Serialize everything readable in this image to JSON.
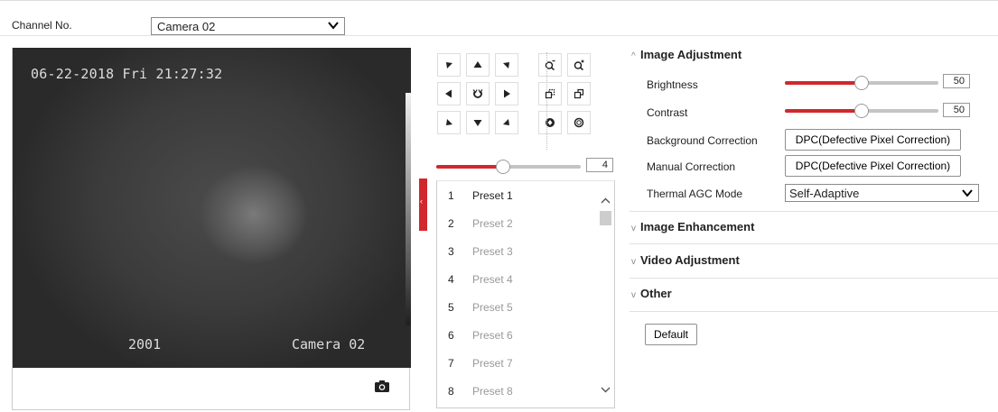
{
  "channel": {
    "label": "Channel No.",
    "selected": "Camera 02"
  },
  "video": {
    "osd_datetime": "06-22-2018 Fri 21:27:32",
    "osd_number": "2001",
    "osd_camera": "Camera 02"
  },
  "ptz": {
    "speed_value": "4",
    "speed_fraction": 0.46,
    "icons": [
      "arrow-up-left-icon",
      "arrow-up-icon",
      "arrow-up-right-icon",
      "zoom-out-icon",
      "zoom-in-icon",
      "arrow-left-icon",
      "auto-rotate-icon",
      "arrow-right-icon",
      "focus-near-icon",
      "focus-far-icon",
      "arrow-down-left-icon",
      "arrow-down-icon",
      "arrow-down-right-icon",
      "iris-close-icon",
      "iris-open-icon"
    ]
  },
  "presets": [
    {
      "num": "1",
      "label": "Preset 1"
    },
    {
      "num": "2",
      "label": "Preset 2"
    },
    {
      "num": "3",
      "label": "Preset 3"
    },
    {
      "num": "4",
      "label": "Preset 4"
    },
    {
      "num": "5",
      "label": "Preset 5"
    },
    {
      "num": "6",
      "label": "Preset 6"
    },
    {
      "num": "7",
      "label": "Preset 7"
    },
    {
      "num": "8",
      "label": "Preset 8"
    }
  ],
  "settings": {
    "image_adjustment": "Image Adjustment",
    "brightness_label": "Brightness",
    "brightness_value": "50",
    "brightness_fraction": 0.5,
    "contrast_label": "Contrast",
    "contrast_value": "50",
    "contrast_fraction": 0.5,
    "background_correction_label": "Background Correction",
    "background_correction_button": "DPC(Defective Pixel Correction)",
    "manual_correction_label": "Manual Correction",
    "manual_correction_button": "DPC(Defective Pixel Correction)",
    "agc_label": "Thermal AGC Mode",
    "agc_value": "Self-Adaptive",
    "image_enhancement": "Image Enhancement",
    "video_adjustment": "Video Adjustment",
    "other": "Other",
    "default_button": "Default"
  },
  "colors": {
    "accent": "#d0282e",
    "track": "#c4c4c4"
  }
}
